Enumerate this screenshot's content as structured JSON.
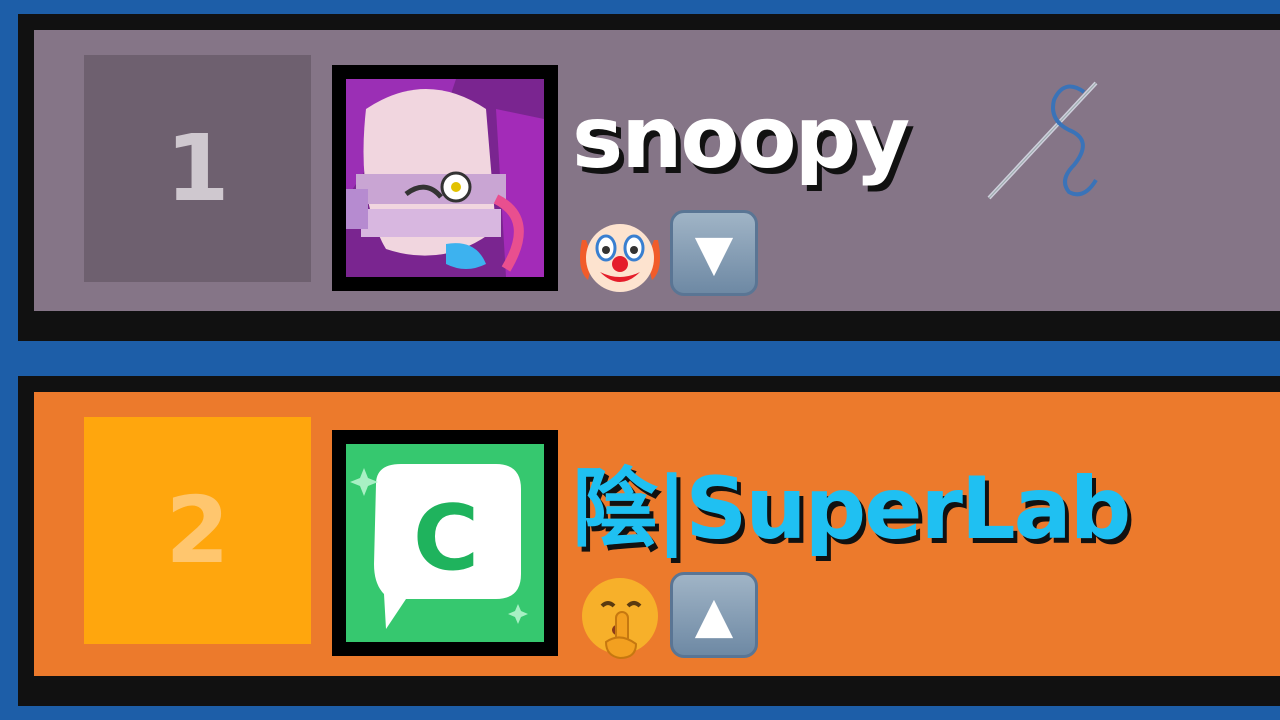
{
  "leaderboard": [
    {
      "rank": "1",
      "name": "snoopy",
      "status_emoji": "clown-face",
      "trend": "down",
      "trend_glyph": "▼",
      "badge_icon": "needle-thread-icon",
      "row_color": "#857587"
    },
    {
      "rank": "2",
      "name": "陰|SuperLab",
      "status_emoji": "shushing-face",
      "trend": "up",
      "trend_glyph": "▲",
      "row_color": "#ec7a2c"
    }
  ]
}
